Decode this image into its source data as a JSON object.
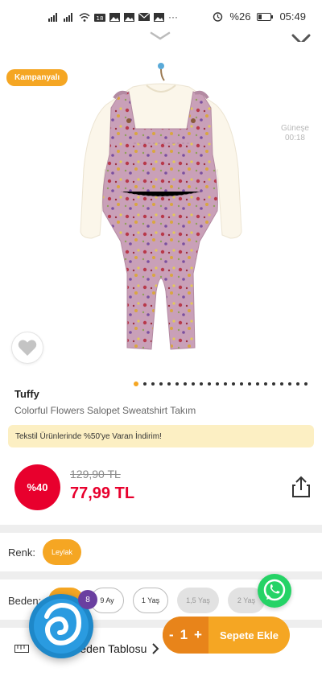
{
  "status_bar": {
    "battery": "%26",
    "time": "05:49",
    "signal_badge": "18"
  },
  "hero": {
    "campaign_badge": "Kampanyalı",
    "watermark_line1": "Güneşe",
    "watermark_line2": "00:18",
    "image_icon": "toddler-overall-outfit-photo",
    "carousel_total": 22,
    "carousel_active": 0
  },
  "product": {
    "brand": "Tuffy",
    "name": "Colorful Flowers Salopet Sweatshirt Takım",
    "promo": "Tekstil Ürünlerinde %50'ye Varan İndirim!",
    "discount_badge": "%40",
    "old_price": "129,90 TL",
    "new_price": "77,99 TL"
  },
  "color_section": {
    "label": "Renk:",
    "selected": "Leylak"
  },
  "size_section": {
    "label": "Beden:",
    "options": [
      "6-9 Ay",
      "9 Ay",
      "1 Yaş",
      "1,5 Yaş",
      "2 Yaş"
    ],
    "option_labels_visible": [
      "",
      "9 Ay",
      "1 Yaş",
      "1,5 Yaş",
      "2 Yaş"
    ]
  },
  "size_guide": {
    "label": "Beden Tablosu"
  },
  "cart": {
    "minus": "-",
    "quantity": "1",
    "plus": "+",
    "button_label": "Sepete Ekle"
  },
  "assistant": {
    "badge_count": "8"
  },
  "colors": {
    "accent": "#f5a623",
    "discount": "#e8002d",
    "promo_bg": "#fcefc3",
    "whatsapp": "#25d366",
    "assistant": "#1e88c9",
    "product_pink": "#c9a0b8"
  }
}
